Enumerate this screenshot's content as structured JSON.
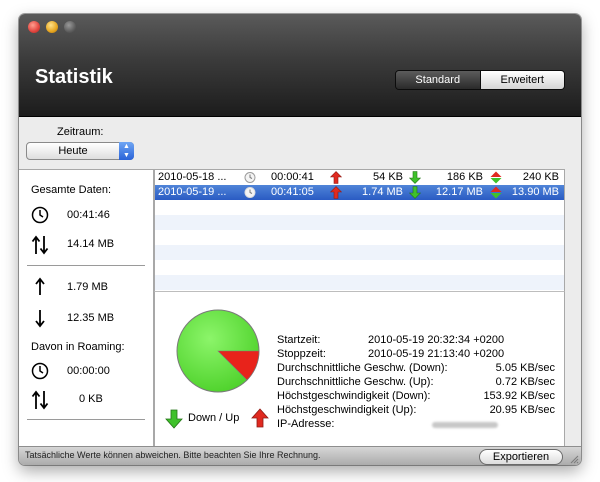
{
  "window": {
    "title": "Statistik",
    "view_toggle": {
      "standard": "Standard",
      "erweitert": "Erweitert",
      "selected": "Standard"
    }
  },
  "filter": {
    "label": "Zeitraum:",
    "value": "Heute"
  },
  "summary": {
    "total_header": "Gesamte Daten:",
    "total_duration": "00:41:46",
    "total_volume": "14.14 MB",
    "upload": "1.79 MB",
    "download": "12.35 MB",
    "roaming_header": "Davon in Roaming:",
    "roaming_duration": "00:00:00",
    "roaming_volume": "0 KB"
  },
  "sessions": [
    {
      "date": "2010-05-18 ...",
      "duration": "00:00:41",
      "up": "54 KB",
      "down": "186 KB",
      "total": "240 KB",
      "selected": false
    },
    {
      "date": "2010-05-19 ...",
      "duration": "00:41:05",
      "up": "1.74 MB",
      "down": "12.17 MB",
      "total": "13.90 MB",
      "selected": true
    }
  ],
  "details": {
    "startzeit_label": "Startzeit:",
    "startzeit_value": "2010-05-19 20:32:34 +0200",
    "stoppzeit_label": "Stoppzeit:",
    "stoppzeit_value": "2010-05-19 21:13:40 +0200",
    "avg_down_label": "Durchschnittliche Geschw. (Down):",
    "avg_down_value": "5.05 KB/sec",
    "avg_up_label": "Durchschnittliche Geschw. (Up):",
    "avg_up_value": "0.72 KB/sec",
    "max_down_label": "Höchstgeschwindigkeit (Down):",
    "max_down_value": "153.92 KB/sec",
    "max_up_label": "Höchstgeschwindigkeit (Up):",
    "max_up_value": "20.95 KB/sec",
    "ip_label": "IP-Adresse:"
  },
  "pie": {
    "down_fraction": 0.875,
    "up_fraction": 0.125,
    "down_color": "#5fe03b",
    "up_color": "#e8231b"
  },
  "legend": {
    "label": "Down / Up"
  },
  "status": {
    "note": "Tatsächliche Werte können abweichen. Bitte beachten Sie Ihre Rechnung.",
    "export": "Exportieren"
  }
}
